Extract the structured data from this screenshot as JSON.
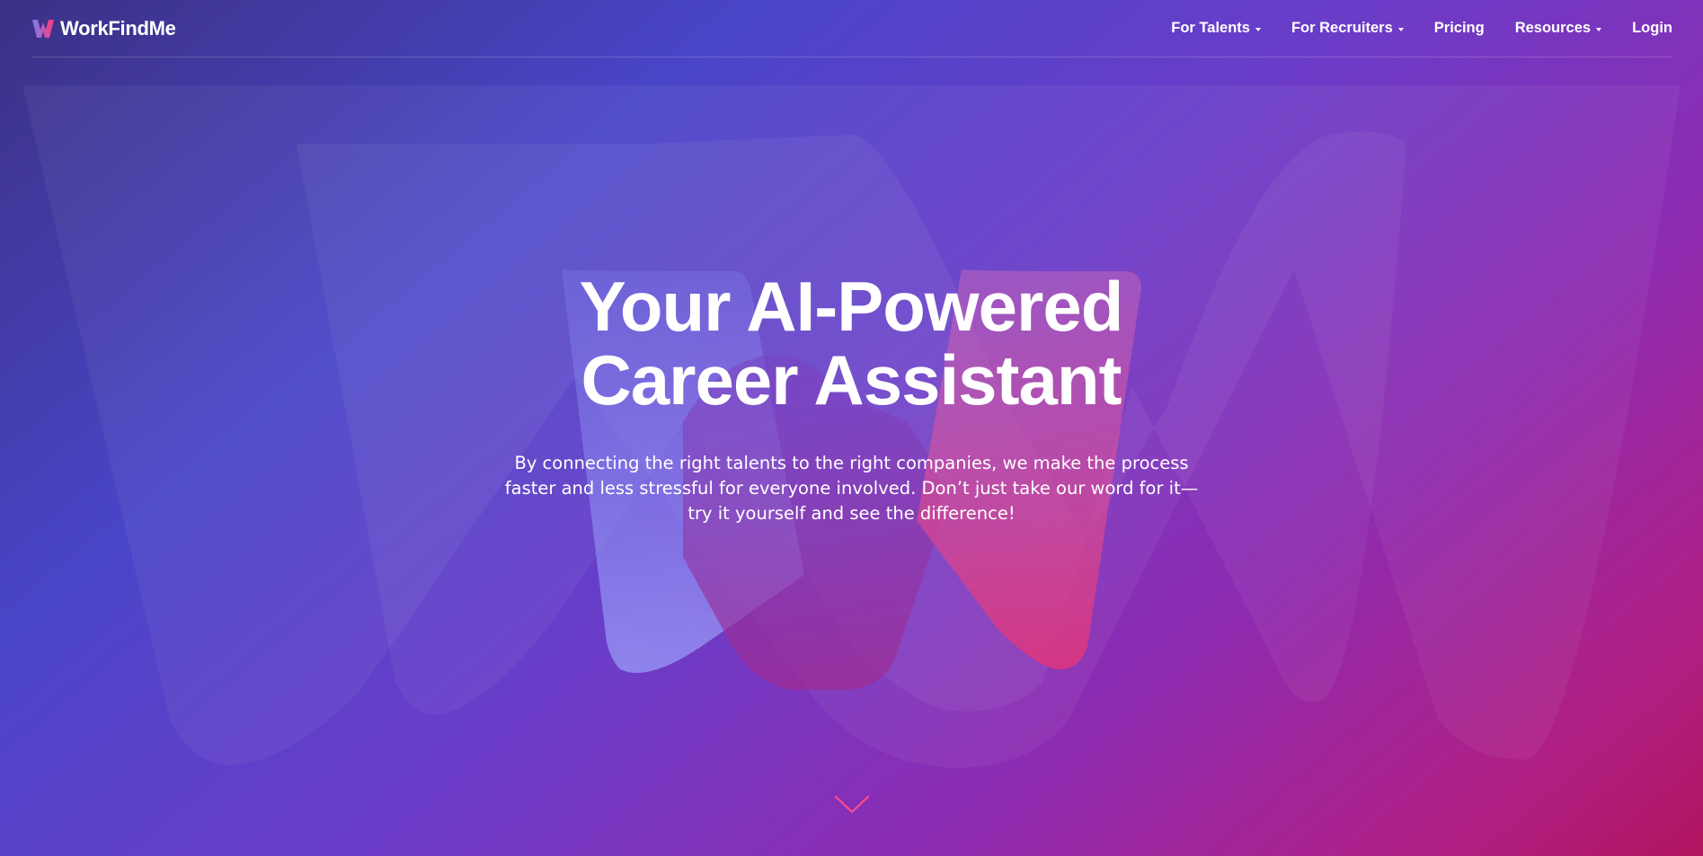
{
  "brand": {
    "name": "WorkFindMe",
    "logo_icon": "w-logo-icon"
  },
  "nav": {
    "items": [
      {
        "label": "For Talents",
        "has_dropdown": true
      },
      {
        "label": "For Recruiters",
        "has_dropdown": true
      },
      {
        "label": "Pricing",
        "has_dropdown": false
      },
      {
        "label": "Resources",
        "has_dropdown": true
      },
      {
        "label": "Login",
        "has_dropdown": false
      }
    ]
  },
  "hero": {
    "title_line1": "Your AI-Powered",
    "title_line2": "Career Assistant",
    "subtitle": "By connecting the right talents to the right companies, we make the process faster and less stressful for everyone involved. Don’t just take our word for it—try it yourself and see the difference!",
    "scroll_icon": "chevron-down-icon"
  },
  "colors": {
    "gradient_start": "#3b3184",
    "gradient_mid": "#6a3dc9",
    "gradient_end": "#b0155f",
    "accent_pink": "#e0357a",
    "accent_indigo": "#7a7ef0"
  }
}
